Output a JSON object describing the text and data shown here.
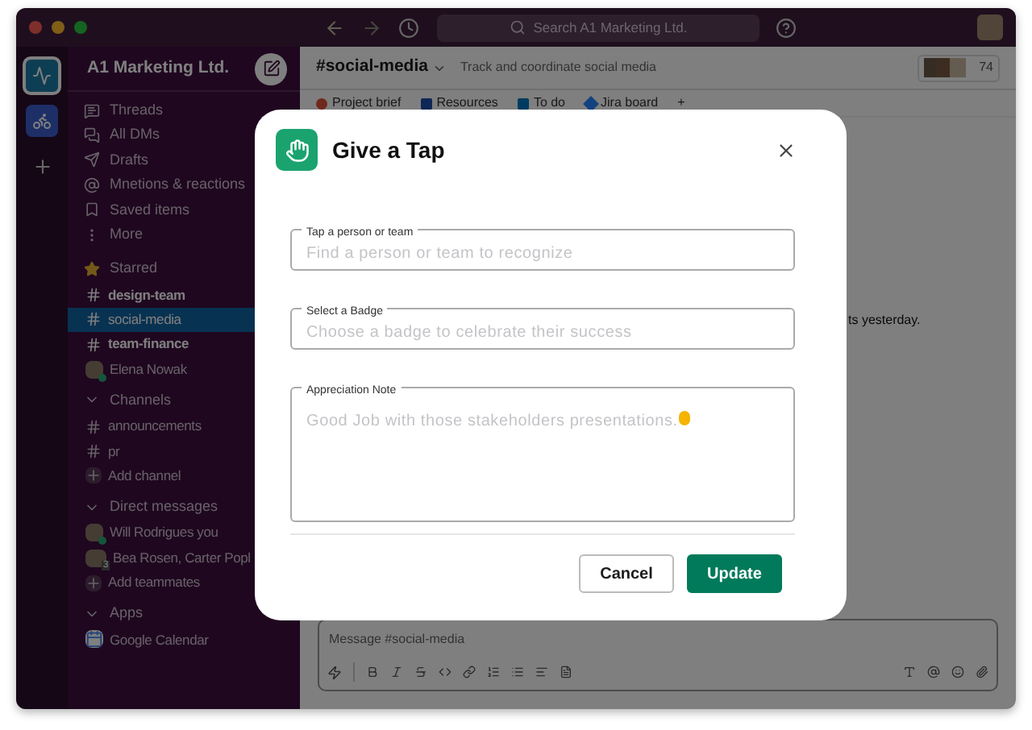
{
  "titlebar": {
    "search_placeholder": "Search A1 Marketing Ltd."
  },
  "sidebar": {
    "workspace": "A1 Marketing Ltd.",
    "nav": [
      "Threads",
      "All DMs",
      "Drafts",
      "Mnetions & reactions",
      "Saved items",
      "More"
    ],
    "sections": [
      {
        "kind": "starred",
        "title": "Starred",
        "expanded": true,
        "items": [
          {
            "kind": "channel",
            "label": "design-team",
            "unread": true,
            "selected": false
          },
          {
            "kind": "channel",
            "label": "social-media",
            "unread": false,
            "selected": true
          },
          {
            "kind": "channel",
            "label": "team-finance",
            "unread": true,
            "selected": false
          },
          {
            "kind": "person",
            "label": "Elena Nowak",
            "online": true,
            "selected": false
          }
        ]
      },
      {
        "kind": "folder",
        "title": "Channels",
        "expanded": true,
        "items": [
          {
            "kind": "channel",
            "label": "announcements",
            "unread": false,
            "selected": false
          },
          {
            "kind": "channel",
            "label": "pr",
            "unread": false,
            "selected": false
          },
          {
            "kind": "add",
            "label": "Add channel",
            "selected": false
          }
        ]
      },
      {
        "kind": "folder",
        "title": "Direct messages",
        "expanded": true,
        "items": [
          {
            "kind": "person",
            "label": "Will Rodrigues you",
            "online": true,
            "selected": false
          },
          {
            "kind": "group",
            "label": "Bea Rosen, Carter Popl",
            "count": "3",
            "selected": false
          },
          {
            "kind": "add",
            "label": "Add teammates",
            "selected": false
          }
        ]
      },
      {
        "kind": "folder",
        "title": "Apps",
        "expanded": true,
        "items": [
          {
            "kind": "app",
            "label": "Google Calendar",
            "selected": false
          }
        ]
      }
    ]
  },
  "channel": {
    "name": "#social-media",
    "topic": "Track and coordinate social media",
    "member_count": "74",
    "bookmarks": [
      {
        "label": "Project brief"
      },
      {
        "label": "Resources"
      },
      {
        "label": "To do"
      },
      {
        "label": "Jira board"
      }
    ],
    "add_bookmark": "+",
    "message_fragment": "ts yesterday.",
    "composer": {
      "placeholder": "Message #social-media"
    }
  },
  "modal": {
    "title": "Give a Tap",
    "fields": [
      {
        "kind": "input",
        "label": "Tap a person or team",
        "placeholder": "Find a person or team to recognize"
      },
      {
        "kind": "input",
        "label": "Select a Badge",
        "placeholder": "Choose a badge to celebrate their success"
      },
      {
        "kind": "textarea",
        "label": "Appreciation Note",
        "placeholder": "Good Job with those stakeholders presentations."
      }
    ],
    "buttons": [
      {
        "kind": "secondary",
        "label": "Cancel"
      },
      {
        "kind": "primary",
        "label": "Update"
      }
    ]
  }
}
